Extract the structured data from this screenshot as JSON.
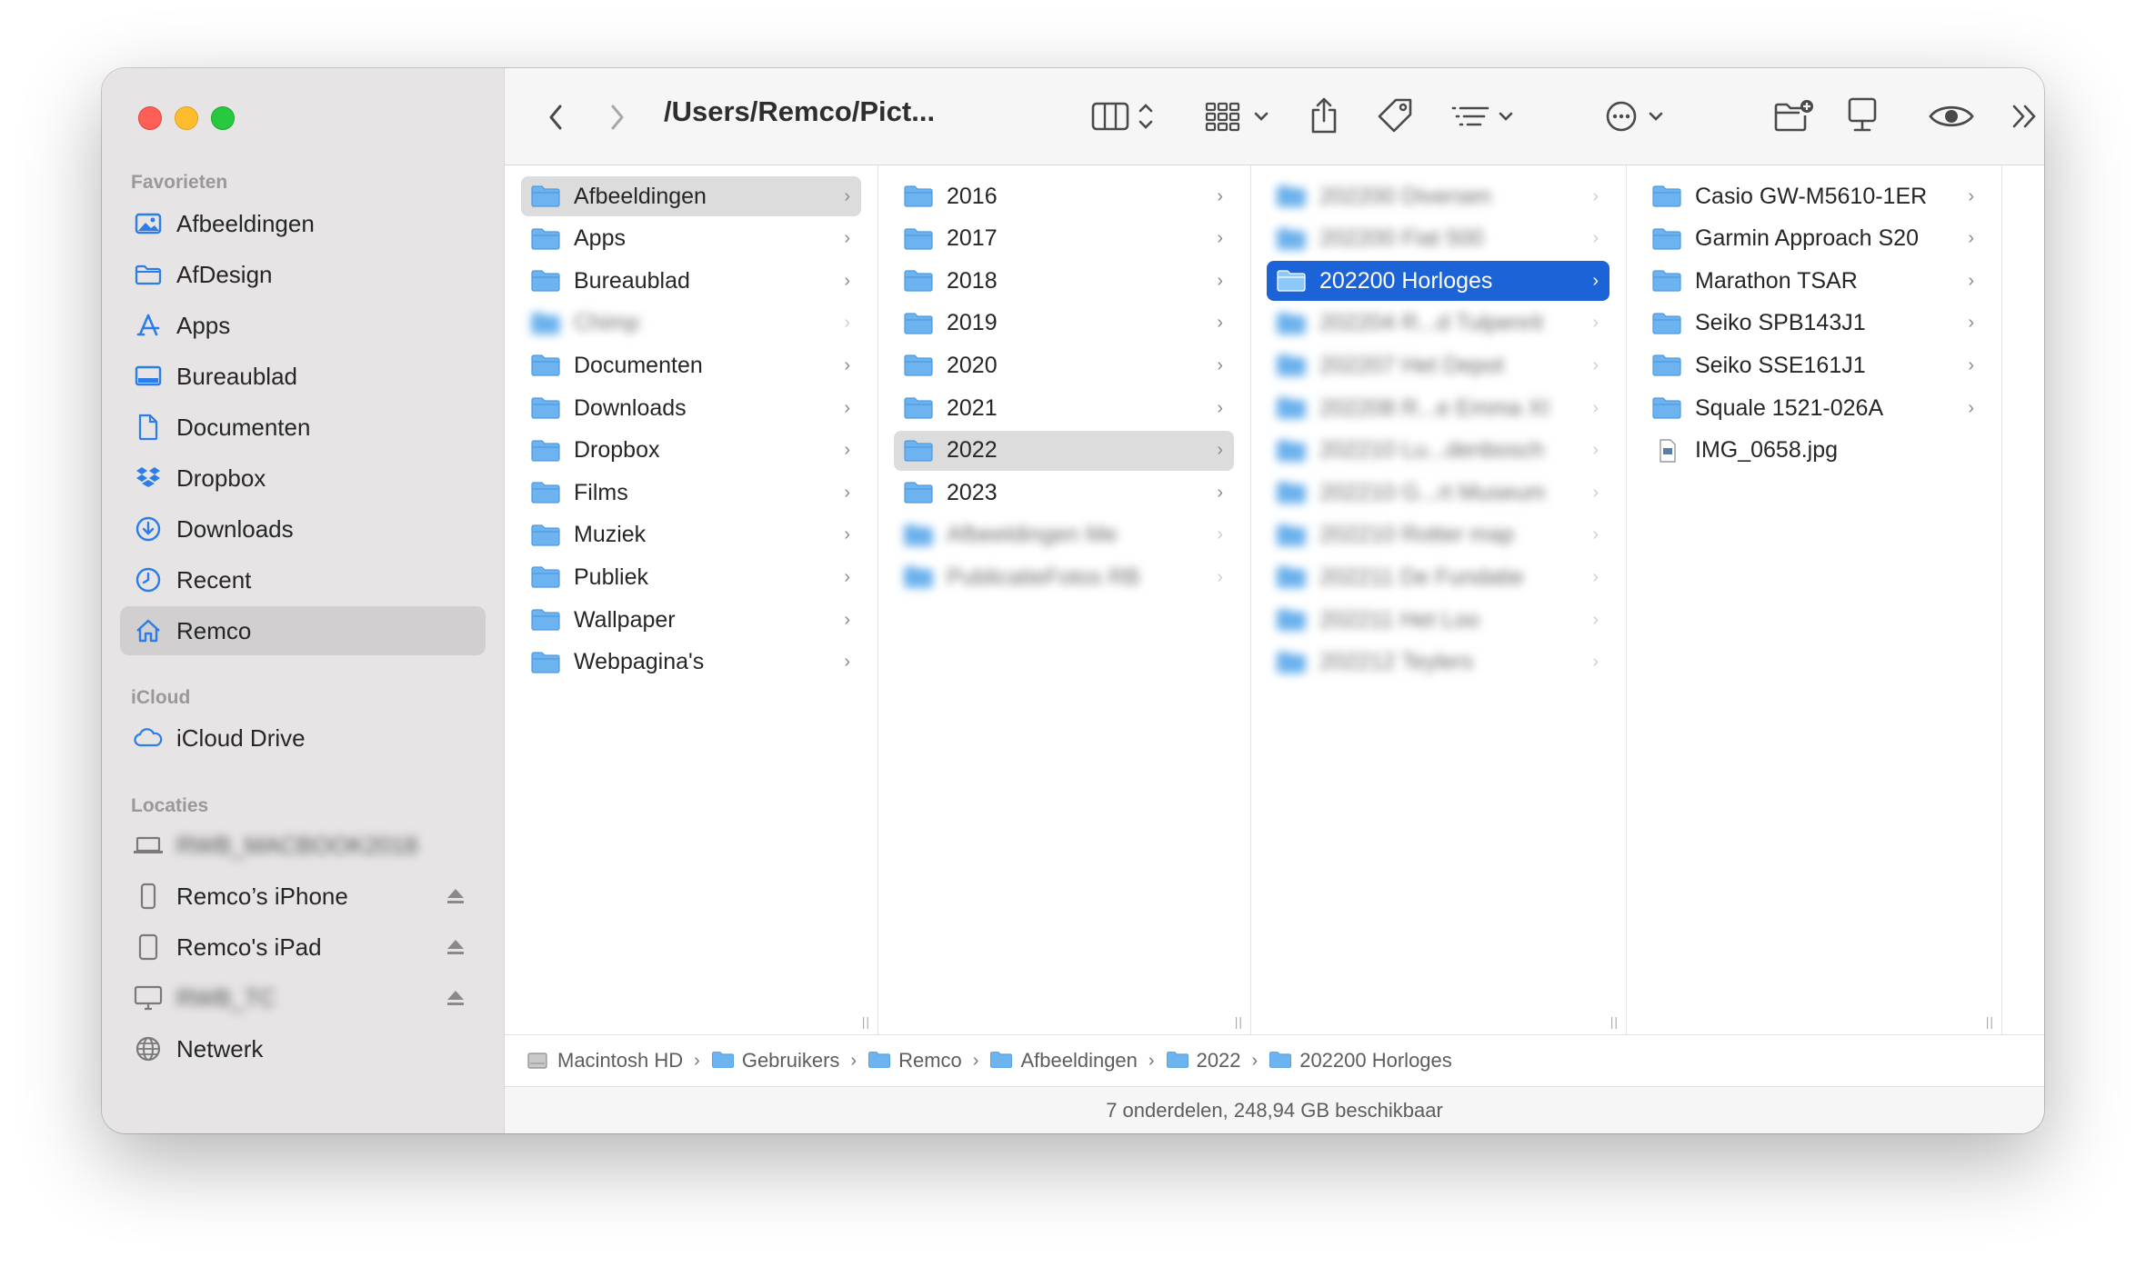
{
  "window": {
    "path_title": "/Users/Remco/Pict..."
  },
  "colors": {
    "accent": "#1d63d8",
    "folder": "#6cb3ef",
    "sidebar_icon": "#2b7de9"
  },
  "sidebar": {
    "favorites_header": "Favorieten",
    "favorites": [
      {
        "label": "Afbeeldingen",
        "icon": "photo-icon"
      },
      {
        "label": "AfDesign",
        "icon": "folder-outline-icon"
      },
      {
        "label": "Apps",
        "icon": "apps-icon"
      },
      {
        "label": "Bureaublad",
        "icon": "desktop-icon"
      },
      {
        "label": "Documenten",
        "icon": "document-icon"
      },
      {
        "label": "Dropbox",
        "icon": "dropbox-icon"
      },
      {
        "label": "Downloads",
        "icon": "download-icon"
      },
      {
        "label": "Recent",
        "icon": "clock-icon"
      },
      {
        "label": "Remco",
        "icon": "home-icon",
        "selected": true
      }
    ],
    "icloud_header": "iCloud",
    "icloud": [
      {
        "label": "iCloud Drive",
        "icon": "cloud-icon"
      }
    ],
    "locations_header": "Locaties",
    "locations": [
      {
        "label": "RWB_MACBOOK2018",
        "icon": "laptop-icon",
        "blurred": true
      },
      {
        "label": "Remco’s iPhone",
        "icon": "iphone-icon",
        "eject": true
      },
      {
        "label": "Remco's iPad",
        "icon": "ipad-icon",
        "eject": true
      },
      {
        "label": "RWB_TC",
        "icon": "display-icon",
        "blurred": true,
        "eject": true
      },
      {
        "label": "Netwerk",
        "icon": "globe-icon"
      }
    ]
  },
  "columns": [
    {
      "items": [
        {
          "label": "Afbeeldingen",
          "state": "gray"
        },
        {
          "label": "Apps"
        },
        {
          "label": "Bureaublad"
        },
        {
          "label": "Chimp",
          "blurred": true
        },
        {
          "label": "Documenten"
        },
        {
          "label": "Downloads"
        },
        {
          "label": "Dropbox"
        },
        {
          "label": "Films"
        },
        {
          "label": "Muziek"
        },
        {
          "label": "Publiek"
        },
        {
          "label": "Wallpaper"
        },
        {
          "label": "Webpagina's"
        }
      ]
    },
    {
      "items": [
        {
          "label": "2016"
        },
        {
          "label": "2017"
        },
        {
          "label": "2018"
        },
        {
          "label": "2019"
        },
        {
          "label": "2020"
        },
        {
          "label": "2021"
        },
        {
          "label": "2022",
          "state": "gray"
        },
        {
          "label": "2023"
        },
        {
          "label": "Afbeeldingen Me",
          "blurred": true
        },
        {
          "label": "PublicatieFotos RB",
          "blurred": true
        }
      ]
    },
    {
      "items": [
        {
          "label": "202200 Diversen",
          "blurred": true
        },
        {
          "label": "202200 Fiat 500",
          "blurred": true
        },
        {
          "label": "202200 Horloges",
          "state": "blue"
        },
        {
          "label": "202204 R...d Tulpenrit",
          "blurred": true
        },
        {
          "label": "202207 Het Depot",
          "blurred": true
        },
        {
          "label": "202208 R...e Emma XI",
          "blurred": true
        },
        {
          "label": "202210 Lu...denbosch",
          "blurred": true
        },
        {
          "label": "202210 G...rt Museum",
          "blurred": true
        },
        {
          "label": "202210 Rotter map",
          "blurred": true
        },
        {
          "label": "202211 De Fundatie",
          "blurred": true
        },
        {
          "label": "202211 Het Loo",
          "blurred": true
        },
        {
          "label": "202212 Teylers",
          "blurred": true
        }
      ]
    },
    {
      "items": [
        {
          "label": "Casio GW-M5610-1ER"
        },
        {
          "label": "Garmin Approach S20"
        },
        {
          "label": "Marathon TSAR"
        },
        {
          "label": "Seiko SPB143J1"
        },
        {
          "label": "Seiko SSE161J1"
        },
        {
          "label": "Squale 1521-026A"
        },
        {
          "label": "IMG_0658.jpg",
          "file": true
        }
      ]
    }
  ],
  "pathbar": [
    {
      "label": "Macintosh HD",
      "icon": "disk-icon"
    },
    {
      "label": "Gebruikers",
      "icon": "folder-icon"
    },
    {
      "label": "Remco",
      "icon": "home-folder-icon"
    },
    {
      "label": "Afbeeldingen",
      "icon": "photo-folder-icon"
    },
    {
      "label": "2022",
      "icon": "folder-icon"
    },
    {
      "label": "202200 Horloges",
      "icon": "folder-icon"
    }
  ],
  "status": "7 onderdelen, 248,94 GB beschikbaar"
}
